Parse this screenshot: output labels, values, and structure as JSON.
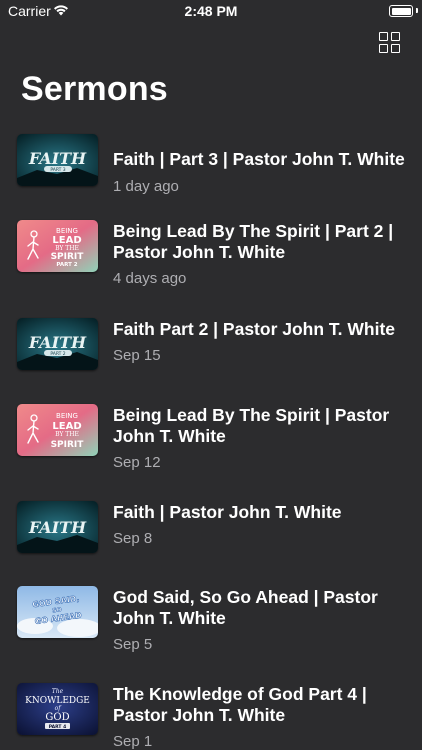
{
  "status_bar": {
    "carrier": "Carrier",
    "time": "2:48 PM"
  },
  "header": {
    "title": "Sermons",
    "view_toggle_icon": "grid-icon"
  },
  "thumbnail_texts": {
    "faith": "FAITH",
    "faith_part3_sub": "PART 3",
    "faith_part2_sub": "PART 2",
    "spirit_line1": "BEING",
    "spirit_line2": "LEAD",
    "spirit_line3": "BY THE",
    "spirit_line4": "SPIRIT",
    "spirit_part2": "PART 2",
    "god_said_line1": "GOD SAID,",
    "god_said_line2": "SO",
    "god_said_line3": "GO AHEAD",
    "knowledge_line1": "The",
    "knowledge_line2": "KNOWLEDGE",
    "knowledge_line3": "of",
    "knowledge_line4": "GOD",
    "knowledge_part": "PART 4"
  },
  "sermons": [
    {
      "title": "Faith | Part 3 | Pastor John T. White",
      "date": "1 day ago",
      "thumbnail": "faith"
    },
    {
      "title": "Being Lead By The Spirit | Part 2 | Pastor John T. White",
      "date": "4 days ago",
      "thumbnail": "spirit"
    },
    {
      "title": "Faith Part 2 | Pastor John T. White",
      "date": "Sep 15",
      "thumbnail": "faith"
    },
    {
      "title": "Being Lead By The Spirit | Pastor John T. White",
      "date": "Sep 12",
      "thumbnail": "spirit"
    },
    {
      "title": "Faith | Pastor John T. White",
      "date": "Sep 8",
      "thumbnail": "faith"
    },
    {
      "title": "God Said, So Go Ahead | Pastor John T. White",
      "date": "Sep 5",
      "thumbnail": "god-said"
    },
    {
      "title": "The Knowledge of God Part 4 | Pastor John T. White",
      "date": "Sep 1",
      "thumbnail": "knowledge"
    }
  ],
  "colors": {
    "background": "#2c2c2e",
    "secondary_text": "#aeaeb2",
    "faith_bg": "#0e3a45",
    "spirit_bg": "#e0667a"
  }
}
